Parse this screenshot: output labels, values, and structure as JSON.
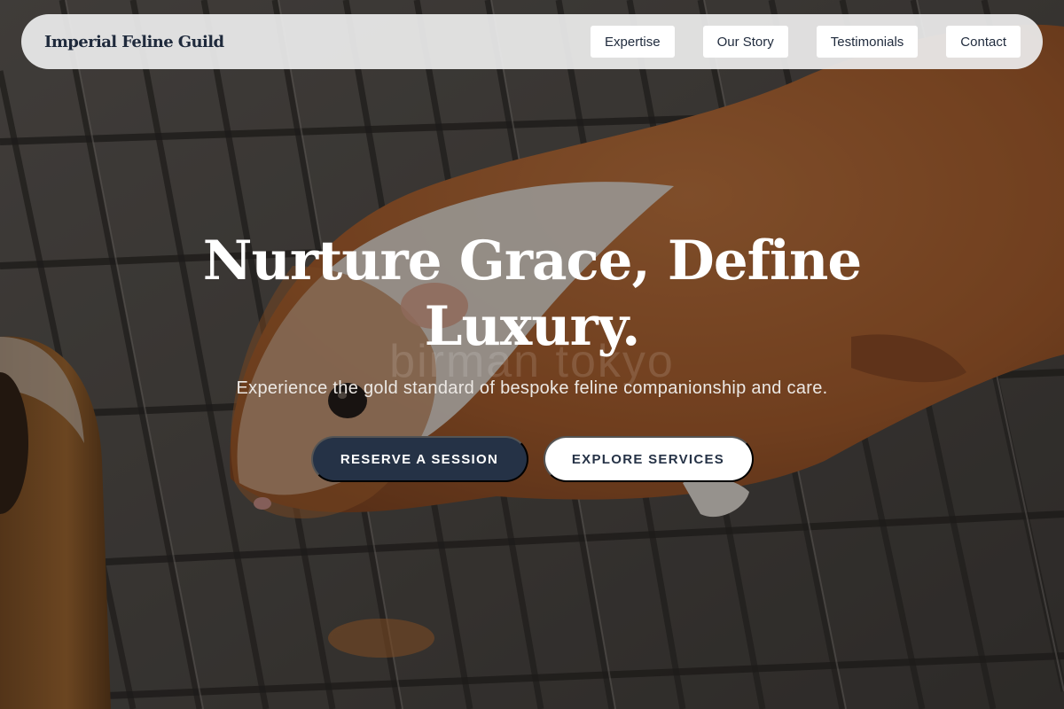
{
  "nav": {
    "brand": "Imperial Feline Guild",
    "links": [
      {
        "label": "Expertise"
      },
      {
        "label": "Our Story"
      },
      {
        "label": "Testimonials"
      },
      {
        "label": "Contact"
      }
    ]
  },
  "hero": {
    "title_line1": "Nurture Grace, Define",
    "title_line2": "Luxury.",
    "subtitle": "Experience the gold standard of bespoke feline companionship and care.",
    "watermark": "birman tokyo",
    "primary_cta": "RESERVE A SESSION",
    "secondary_cta": "EXPLORE SERVICES"
  },
  "colors": {
    "brand_navy": "#253246",
    "nav_bar": "#ececec",
    "button_white": "#ffffff"
  }
}
